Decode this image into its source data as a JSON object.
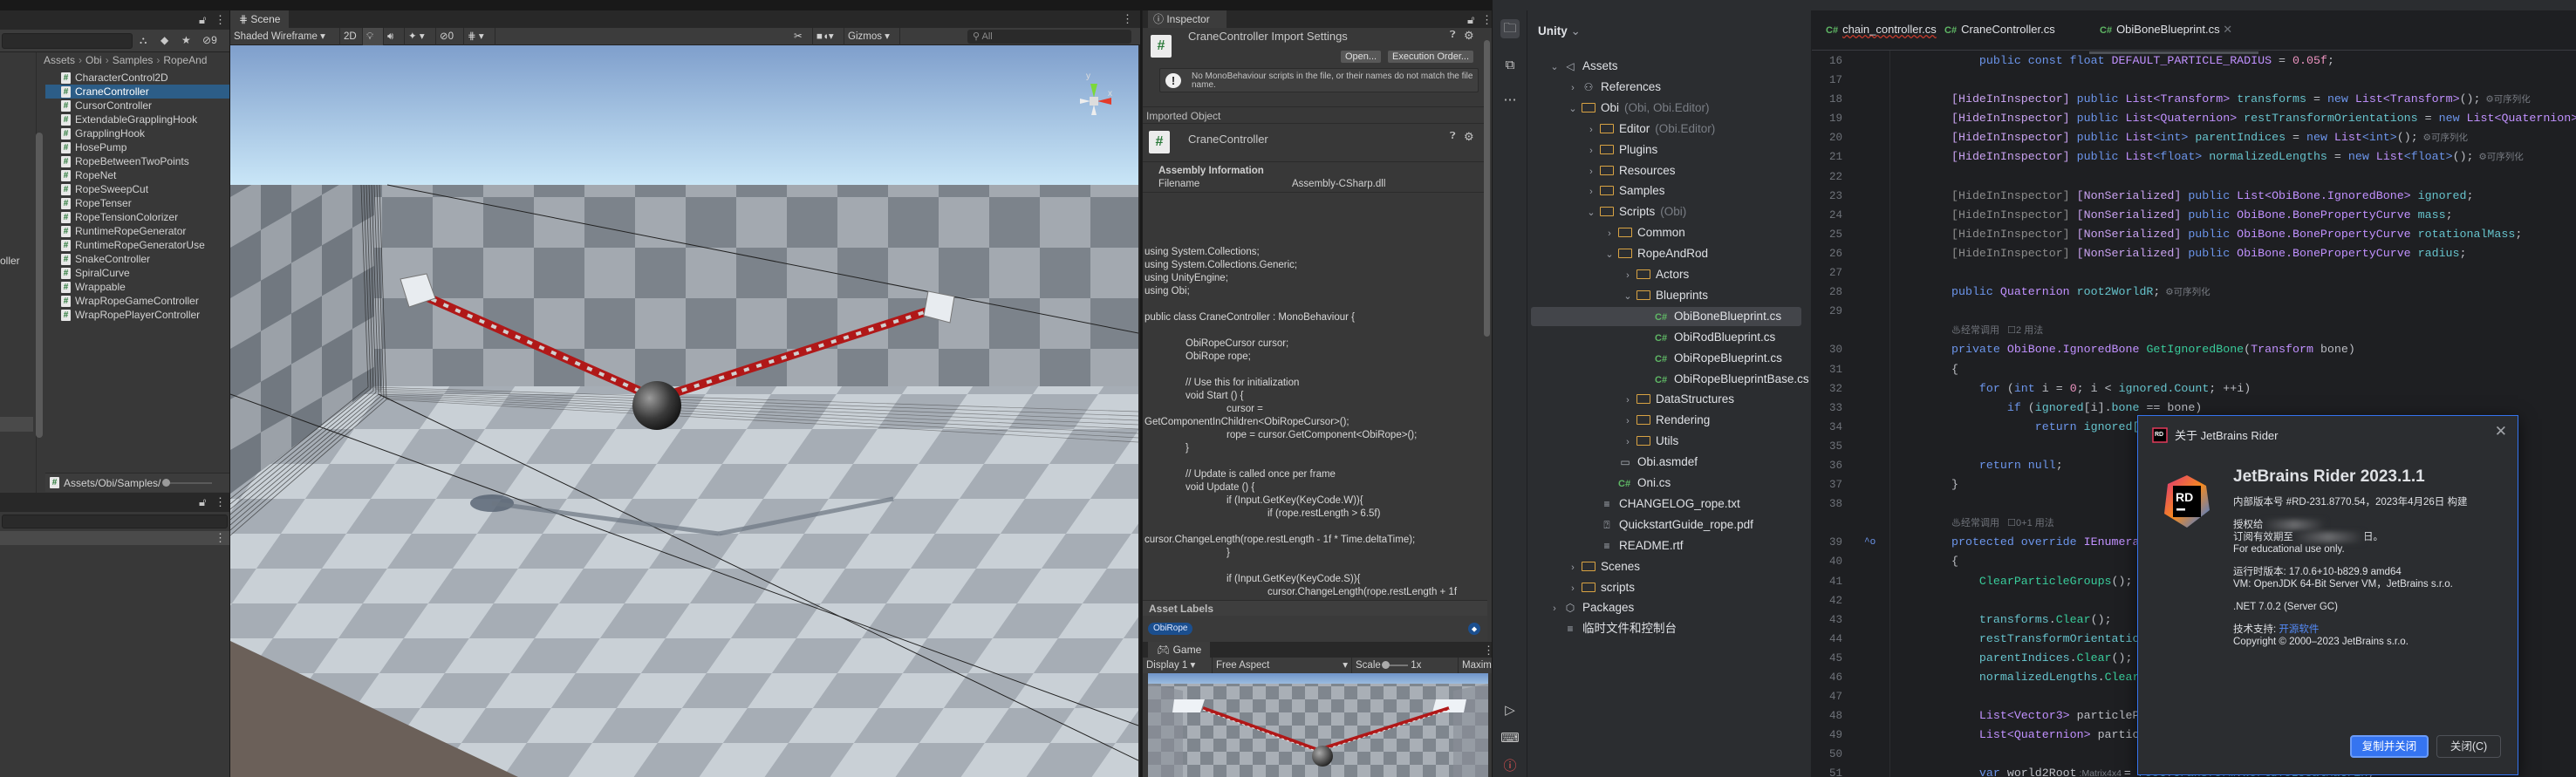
{
  "colors": {
    "unity_selection": "#2c5d87",
    "rider_accent": "#3574f0",
    "rope_red": "#b01818"
  },
  "project_panel": {
    "search_placeholder": "",
    "hidden_count": "9",
    "folder_tree_cut_label": "oller",
    "breadcrumb": [
      "Assets",
      "Obi",
      "Samples",
      "RopeAnd"
    ],
    "files": [
      "CharacterControl2D",
      "CraneController",
      "CursorController",
      "ExtendableGrapplingHook",
      "GrapplingHook",
      "HosePump",
      "RopeBetweenTwoPoints",
      "RopeNet",
      "RopeSweepCut",
      "RopeTenser",
      "RopeTensionColorizer",
      "RuntimeRopeGenerator",
      "RuntimeRopeGeneratorUse",
      "SnakeController",
      "SpiralCurve",
      "Wrappable",
      "WrapRopeGameController",
      "WrapRopePlayerController"
    ],
    "selected_file_index": 1,
    "path": "Assets/Obi/Samples/"
  },
  "scene": {
    "tab": "Scene",
    "shading_mode": "Shaded Wireframe",
    "mode_2d": "2D",
    "hidden_count": "0",
    "gizmos": "Gizmos",
    "search_placeholder": "All",
    "axis_y": "y",
    "axis_x": "x"
  },
  "inspector": {
    "tab": "Inspector",
    "title": "CraneController Import Settings",
    "open_button": "Open...",
    "execution_order_button": "Execution Order...",
    "warning": "No MonoBehaviour scripts in the file, or their names do not match the file name.",
    "imported_object_header": "Imported Object",
    "object_name": "CraneController",
    "assembly_header": "Assembly Information",
    "filename_label": "Filename",
    "filename_value": "Assembly-CSharp.dll",
    "code_lines": [
      "using System.Collections;",
      "using System.Collections.Generic;",
      "using UnityEngine;",
      "using Obi;",
      "",
      "public class CraneController : MonoBehaviour {",
      "",
      "\tObiRopeCursor cursor;",
      "\tObiRope rope;",
      "",
      "\t// Use this for initialization",
      "\tvoid Start () {",
      "\t\tcursor =",
      "GetComponentInChildren<ObiRopeCursor>();",
      "\t\trope = cursor.GetComponent<ObiRope>();",
      "\t}",
      "",
      "\t// Update is called once per frame",
      "\tvoid Update () {",
      "\t\tif (Input.GetKey(KeyCode.W)){",
      "\t\t\tif (rope.restLength > 6.5f)",
      "",
      "cursor.ChangeLength(rope.restLength - 1f * Time.deltaTime);",
      "\t\t}",
      "",
      "\t\tif (Input.GetKey(KeyCode.S)){",
      "\t\t\tcursor.ChangeLength(rope.restLength + 1f"
    ],
    "asset_labels_header": "Asset Labels",
    "asset_label": "ObiRope"
  },
  "game": {
    "tab": "Game",
    "display": "Display 1",
    "aspect": "Free Aspect",
    "scale_label": "Scale",
    "scale_value": "1x",
    "maximize": "Maxim"
  },
  "rider": {
    "tree_header": "Unity",
    "tree": [
      {
        "label": "Assets",
        "depth": 0,
        "chev": "v",
        "icon": "unity"
      },
      {
        "label": "References",
        "depth": 1,
        "chev": ">",
        "icon": "refs"
      },
      {
        "label": "Obi",
        "hint": "(Obi, Obi.Editor)",
        "depth": 1,
        "chev": "v",
        "icon": "folder"
      },
      {
        "label": "Editor",
        "hint": "(Obi.Editor)",
        "depth": 2,
        "chev": ">",
        "icon": "folder"
      },
      {
        "label": "Plugins",
        "depth": 2,
        "chev": ">",
        "icon": "folder"
      },
      {
        "label": "Resources",
        "depth": 2,
        "chev": ">",
        "icon": "folder"
      },
      {
        "label": "Samples",
        "depth": 2,
        "chev": ">",
        "icon": "folder"
      },
      {
        "label": "Scripts",
        "hint": "(Obi)",
        "depth": 2,
        "chev": "v",
        "icon": "folder"
      },
      {
        "label": "Common",
        "depth": 3,
        "chev": ">",
        "icon": "folder"
      },
      {
        "label": "RopeAndRod",
        "depth": 3,
        "chev": "v",
        "icon": "folder"
      },
      {
        "label": "Actors",
        "depth": 4,
        "chev": ">",
        "icon": "folder"
      },
      {
        "label": "Blueprints",
        "depth": 4,
        "chev": "v",
        "icon": "folder"
      },
      {
        "label": "ObiBoneBlueprint.cs",
        "depth": 5,
        "chev": "",
        "icon": "cs",
        "selected": true
      },
      {
        "label": "ObiRodBlueprint.cs",
        "depth": 5,
        "chev": "",
        "icon": "cs"
      },
      {
        "label": "ObiRopeBlueprint.cs",
        "depth": 5,
        "chev": "",
        "icon": "cs"
      },
      {
        "label": "ObiRopeBlueprintBase.cs",
        "depth": 5,
        "chev": "",
        "icon": "cs"
      },
      {
        "label": "DataStructures",
        "depth": 4,
        "chev": ">",
        "icon": "folder"
      },
      {
        "label": "Rendering",
        "depth": 4,
        "chev": ">",
        "icon": "folder"
      },
      {
        "label": "Utils",
        "depth": 4,
        "chev": ">",
        "icon": "folder"
      },
      {
        "label": "Obi.asmdef",
        "depth": 3,
        "chev": "",
        "icon": "asmdef"
      },
      {
        "label": "Oni.cs",
        "depth": 3,
        "chev": "",
        "icon": "cs"
      },
      {
        "label": "CHANGELOG_rope.txt",
        "depth": 2,
        "chev": "",
        "icon": "text"
      },
      {
        "label": "QuickstartGuide_rope.pdf",
        "depth": 2,
        "chev": "",
        "icon": "pdf"
      },
      {
        "label": "README.rtf",
        "depth": 2,
        "chev": "",
        "icon": "text"
      },
      {
        "label": "Scenes",
        "depth": 1,
        "chev": ">",
        "icon": "folder"
      },
      {
        "label": "scripts",
        "depth": 1,
        "chev": ">",
        "icon": "folder"
      },
      {
        "label": "Packages",
        "depth": 0,
        "chev": ">",
        "icon": "package"
      },
      {
        "label": "临时文件和控制台",
        "depth": 0,
        "chev": "",
        "icon": "scratch"
      }
    ],
    "tabs": [
      "chain_controller.cs",
      "CraneController.cs",
      "ObiBoneBlueprint.cs"
    ],
    "active_tab": 2,
    "code": [
      {
        "n": "16",
        "s": [
          [
            "    ",
            ""
          ],
          [
            "public",
            "kw"
          ],
          [
            " const float ",
            "kw"
          ],
          [
            "DEFAULT_PARTICLE_RADIUS",
            "ty"
          ],
          [
            " = ",
            "pl"
          ],
          [
            "0.05f",
            "nm"
          ],
          [
            ";",
            "pl"
          ]
        ]
      },
      {
        "n": "17",
        "s": []
      },
      {
        "n": "18",
        "s": [
          [
            "[HideInInspector] ",
            "at"
          ],
          [
            "public ",
            "kw"
          ],
          [
            "List",
            "ty"
          ],
          [
            "<Transform> ",
            "ty"
          ],
          [
            "transforms",
            "fd"
          ],
          [
            " = ",
            "pl"
          ],
          [
            "new",
            "kw"
          ],
          [
            " List",
            "ty"
          ],
          [
            "<Transform>",
            "ty"
          ],
          [
            "();",
            "pl"
          ],
          [
            "  ⚙可序列化",
            "dim"
          ]
        ]
      },
      {
        "n": "19",
        "s": [
          [
            "[HideInInspector] ",
            "at"
          ],
          [
            "public ",
            "kw"
          ],
          [
            "List",
            "ty"
          ],
          [
            "<Quaternion> ",
            "ty"
          ],
          [
            "restTransformOrientations",
            "fd"
          ],
          [
            " = ",
            "pl"
          ],
          [
            "new",
            "kw"
          ],
          [
            " List",
            "ty"
          ],
          [
            "<Quaternion>",
            "ty"
          ]
        ]
      },
      {
        "n": "20",
        "s": [
          [
            "[HideInInspector] ",
            "at"
          ],
          [
            "public ",
            "kw"
          ],
          [
            "List",
            "ty"
          ],
          [
            "<int> ",
            "kw"
          ],
          [
            "parentIndices",
            "fd"
          ],
          [
            " = ",
            "pl"
          ],
          [
            "new",
            "kw"
          ],
          [
            " List",
            "ty"
          ],
          [
            "<int>",
            "kw"
          ],
          [
            "();",
            "pl"
          ],
          [
            "  ⚙可序列化",
            "dim"
          ]
        ]
      },
      {
        "n": "21",
        "s": [
          [
            "[HideInInspector] ",
            "at"
          ],
          [
            "public ",
            "kw"
          ],
          [
            "List",
            "ty"
          ],
          [
            "<float> ",
            "kw"
          ],
          [
            "normalizedLengths",
            "fd"
          ],
          [
            " = ",
            "pl"
          ],
          [
            "new",
            "kw"
          ],
          [
            " List",
            "ty"
          ],
          [
            "<float>",
            "kw"
          ],
          [
            "();",
            "pl"
          ],
          [
            "  ⚙可序列化",
            "dim"
          ]
        ]
      },
      {
        "n": "22",
        "s": []
      },
      {
        "n": "23",
        "s": [
          [
            "[HideInInspector] ",
            "at2"
          ],
          [
            "[NonSerialized] ",
            "at"
          ],
          [
            "public ",
            "kw"
          ],
          [
            "List",
            "ty"
          ],
          [
            "<ObiBone.IgnoredBone> ",
            "ty"
          ],
          [
            "ignored",
            "fd"
          ],
          [
            ";",
            "pl"
          ]
        ]
      },
      {
        "n": "24",
        "s": [
          [
            "[HideInInspector] ",
            "at2"
          ],
          [
            "[NonSerialized] ",
            "at"
          ],
          [
            "public ",
            "kw"
          ],
          [
            "ObiBone.BonePropertyCurve ",
            "ty"
          ],
          [
            "mass",
            "fd"
          ],
          [
            ";",
            "pl"
          ]
        ]
      },
      {
        "n": "25",
        "s": [
          [
            "[HideInInspector] ",
            "at2"
          ],
          [
            "[NonSerialized] ",
            "at"
          ],
          [
            "public ",
            "kw"
          ],
          [
            "ObiBone.BonePropertyCurve ",
            "ty"
          ],
          [
            "rotationalMass",
            "fd"
          ],
          [
            ";",
            "pl"
          ]
        ]
      },
      {
        "n": "26",
        "s": [
          [
            "[HideInInspector] ",
            "at2"
          ],
          [
            "[NonSerialized] ",
            "at"
          ],
          [
            "public ",
            "kw"
          ],
          [
            "ObiBone.BonePropertyCurve ",
            "ty"
          ],
          [
            "radius",
            "fd"
          ],
          [
            ";",
            "pl"
          ]
        ]
      },
      {
        "n": "27",
        "s": []
      },
      {
        "n": "28",
        "s": [
          [
            "public ",
            "kw"
          ],
          [
            "Quaternion ",
            "ty"
          ],
          [
            "root2WorldR",
            "fd"
          ],
          [
            ";",
            "pl"
          ],
          [
            "  ⚙可序列化",
            "dim"
          ]
        ]
      },
      {
        "n": "29",
        "s": []
      },
      {
        "n": "",
        "hint": "♨经常调用   ☐2 用法"
      },
      {
        "n": "30",
        "s": [
          [
            "private ",
            "kw"
          ],
          [
            "ObiBone.IgnoredBone ",
            "ty"
          ],
          [
            "GetIgnoredBone",
            "fn"
          ],
          [
            "(",
            "pl"
          ],
          [
            "Transform",
            "ty"
          ],
          [
            " bone)",
            "pl"
          ]
        ]
      },
      {
        "n": "31",
        "s": [
          [
            "{",
            "pl"
          ]
        ]
      },
      {
        "n": "32",
        "s": [
          [
            "    for",
            "kw"
          ],
          [
            " (",
            "pl"
          ],
          [
            "int",
            "kw"
          ],
          [
            " i = ",
            "pl"
          ],
          [
            "0",
            "nm"
          ],
          [
            "; i < ",
            "pl"
          ],
          [
            "ignored.Count",
            "fd"
          ],
          [
            "; ++i)",
            "pl"
          ]
        ]
      },
      {
        "n": "33",
        "s": [
          [
            "        if",
            "kw"
          ],
          [
            " (",
            "pl"
          ],
          [
            "ignored",
            "fd"
          ],
          [
            "[i].",
            "pl"
          ],
          [
            "bone",
            "fd"
          ],
          [
            " == bone)",
            "pl"
          ]
        ]
      },
      {
        "n": "34",
        "s": [
          [
            "            return ",
            "kw"
          ],
          [
            "ignored[",
            "fd"
          ]
        ]
      },
      {
        "n": "35",
        "s": []
      },
      {
        "n": "36",
        "s": [
          [
            "    return null",
            "kw"
          ],
          [
            ";",
            "pl"
          ]
        ]
      },
      {
        "n": "37",
        "s": [
          [
            "}",
            "pl"
          ]
        ]
      },
      {
        "n": "38",
        "s": []
      },
      {
        "n": "",
        "hint": "♨经常调用   ☐0+1 用法"
      },
      {
        "n": "39",
        "s": [
          [
            "protected override ",
            "kw"
          ],
          [
            "IEnumera",
            "ty"
          ]
        ],
        "gutter": "^o"
      },
      {
        "n": "40",
        "s": [
          [
            "{",
            "pl"
          ]
        ]
      },
      {
        "n": "41",
        "s": [
          [
            "    ClearParticleGroups",
            "fn"
          ],
          [
            "();",
            "pl"
          ]
        ]
      },
      {
        "n": "42",
        "s": []
      },
      {
        "n": "43",
        "s": [
          [
            "    transforms",
            "fd"
          ],
          [
            ".",
            "pl"
          ],
          [
            "Clear",
            "fn"
          ],
          [
            "();",
            "pl"
          ]
        ]
      },
      {
        "n": "44",
        "s": [
          [
            "    restTransformOrientatio",
            "fd"
          ]
        ]
      },
      {
        "n": "45",
        "s": [
          [
            "    parentIndices",
            "fd"
          ],
          [
            ".",
            "pl"
          ],
          [
            "Clear",
            "fn"
          ],
          [
            "();",
            "pl"
          ]
        ]
      },
      {
        "n": "46",
        "s": [
          [
            "    normalizedLengths",
            "fd"
          ],
          [
            ".",
            "pl"
          ],
          [
            "Clear",
            "fn"
          ]
        ]
      },
      {
        "n": "47",
        "s": []
      },
      {
        "n": "48",
        "s": [
          [
            "    List",
            "ty"
          ],
          [
            "<Vector3> ",
            "ty"
          ],
          [
            "particleP",
            "pl"
          ]
        ]
      },
      {
        "n": "49",
        "s": [
          [
            "    List",
            "ty"
          ],
          [
            "<Quaternion> ",
            "ty"
          ],
          [
            "particleOrientations = ",
            "pl"
          ],
          [
            "new",
            "kw"
          ],
          [
            " List",
            "ty"
          ],
          [
            "<Quaternion>",
            "ty"
          ],
          [
            "();",
            "pl"
          ]
        ]
      },
      {
        "n": "50",
        "s": []
      },
      {
        "n": "51",
        "s": [
          [
            "    var ",
            "kw"
          ],
          [
            "world2Root",
            "pl"
          ],
          [
            " :Matrix4x4 ",
            "dim"
          ],
          [
            "= ",
            "pl"
          ],
          [
            "root",
            "fd"
          ],
          [
            ".",
            "pl"
          ],
          [
            "transform",
            "fd"
          ],
          [
            ".",
            "pl"
          ],
          [
            "worldToLocalMatrix",
            "fd"
          ],
          [
            ";",
            "pl"
          ]
        ]
      }
    ]
  },
  "dialog": {
    "title": "关于 JetBrains Rider",
    "logo_text": "RD",
    "product": "JetBrains Rider 2023.1.1",
    "build": "内部版本号 #RD-231.8770.54，2023年4月26日 构建",
    "licensed_to": "授权给",
    "subscription": "订阅有效期至",
    "subscription_suffix": "日。",
    "educational": "For educational use only.",
    "runtime": "运行时版本: 17.0.6+10-b829.9 amd64",
    "vm": "VM: OpenJDK 64-Bit Server VM，JetBrains s.r.o.",
    "dotnet": ".NET 7.0.2 (Server GC)",
    "support_label": "技术支持: ",
    "support_link": "开源软件",
    "copyright": "Copyright © 2000–2023 JetBrains s.r.o.",
    "copy_close_button": "复制并关闭",
    "close_button": "关闭(C)"
  }
}
